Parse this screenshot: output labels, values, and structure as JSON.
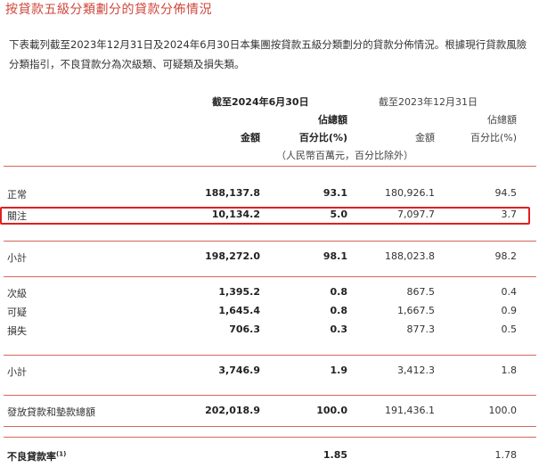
{
  "title": "按貸款五級分類劃分的貸款分佈情況",
  "intro": "下表載列截至2023年12月31日及2024年6月30日本集團按貸款五級分類劃分的貸款分佈情況。根據現行貸款風險分類指引，不良貸款分為次級類、可疑類及損失類。",
  "header": {
    "period1": "截至2024年6月30日",
    "period2": "截至2023年12月31日",
    "share_top1": "佔總額",
    "share_top2": "佔總額",
    "amount1": "金額",
    "percent1": "百分比(%)",
    "amount2": "金額",
    "percent2": "百分比(%)",
    "unit": "（人民幣百萬元，百分比除外）"
  },
  "rows": [
    {
      "label": "正常",
      "a1": "188,137.8",
      "p1": "93.1",
      "a2": "180,926.1",
      "p2": "94.5"
    },
    {
      "label": "關注",
      "a1": "10,134.2",
      "p1": "5.0",
      "a2": "7,097.7",
      "p2": "3.7"
    },
    {
      "label": "小計",
      "a1": "198,272.0",
      "p1": "98.1",
      "a2": "188,023.8",
      "p2": "98.2"
    },
    {
      "label": "次級",
      "a1": "1,395.2",
      "p1": "0.8",
      "a2": "867.5",
      "p2": "0.4"
    },
    {
      "label": "可疑",
      "a1": "1,645.4",
      "p1": "0.8",
      "a2": "1,667.5",
      "p2": "0.9"
    },
    {
      "label": "損失",
      "a1": "706.3",
      "p1": "0.3",
      "a2": "877.3",
      "p2": "0.5"
    },
    {
      "label": "小計",
      "a1": "3,746.9",
      "p1": "1.9",
      "a2": "3,412.3",
      "p2": "1.8"
    },
    {
      "label": "發放貸款和墊款總額",
      "a1": "202,018.9",
      "p1": "100.0",
      "a2": "191,436.1",
      "p2": "100.0"
    }
  ],
  "npl": {
    "label": "不良貸款率",
    "note": "(1)",
    "v1": "1.85",
    "v2": "1.78"
  },
  "colors": {
    "title": "#d0473c",
    "rule": "#d8665e",
    "highlight_box": "#e02020"
  }
}
